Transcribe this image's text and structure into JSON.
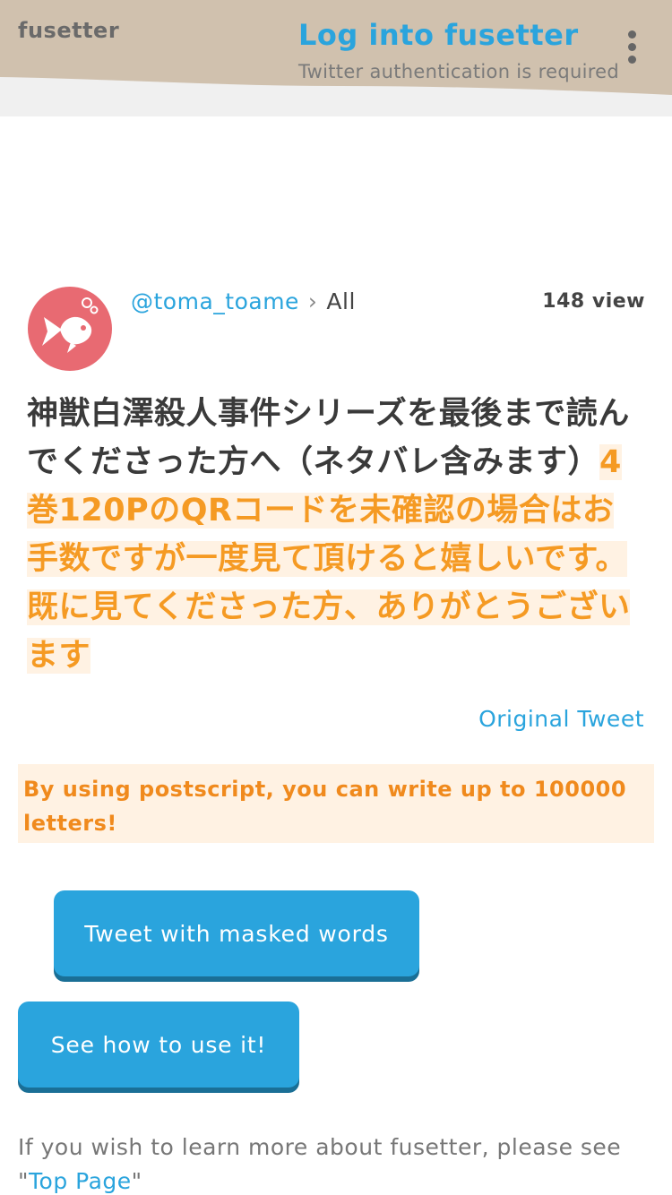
{
  "header": {
    "brand": "fusetter",
    "login_title": "Log into fusetter",
    "login_subtitle": "Twitter authentication is required",
    "menu_icon": "kebab-menu-icon",
    "bg_color": "#d0c1ae"
  },
  "post": {
    "avatar_icon": "goldfish-avatar-icon",
    "username": "@toma_toame",
    "separator": "›",
    "category": "All",
    "views": "148 view",
    "text_plain": "神獣白澤殺人事件シリーズを最後まで読んでくださった方へ（ネタバレ含みます）",
    "text_masked": "4巻120PのQRコードを未確認の場合はお手数ですが一度見て頂けると嬉しいです。既に見てくださった方、ありがとうございます",
    "masked_trailing_glyph": "",
    "original_tweet": "Original Tweet"
  },
  "notice": {
    "text": "By using postscript, you can write up to 100000 letters!"
  },
  "buttons": {
    "tweet_masked": "Tweet with masked words",
    "how_to_use": "See how to use it!"
  },
  "footer": {
    "prefix": "If you wish to learn more about fusetter, please see \"",
    "link": "Top Page",
    "suffix": "\""
  },
  "colors": {
    "accent": "#2aa4dd",
    "masked_text": "#f59a23",
    "masked_bg": "#fff2e3",
    "avatar": "#e86a72"
  }
}
